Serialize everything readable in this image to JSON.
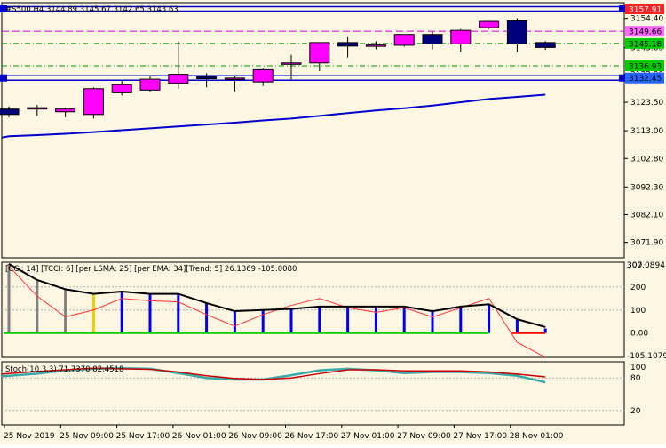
{
  "colors": {
    "background": "#fdf6e3",
    "frame": "#000000",
    "bull_candle": "#ff00ff",
    "bear_candle": "#00007a",
    "ema_line": "#0000cc",
    "hline_blue": "#0000cc",
    "hline_magenta": "#cc00cc",
    "hline_green": "#009900",
    "cci_bar_blue": "#0000ee",
    "cci_bar_gray": "#808080",
    "cci_bar_yellow": "#e8d000",
    "cci_line": "#000000",
    "cci_signal": "#ff3333",
    "cci_zero_green": "#00cc00",
    "cci_zero_red": "#ff0000",
    "stoch_main": "#3aa9a9",
    "stoch_signal": "#cc0000"
  },
  "chart_data": [
    {
      "type": "candlestick",
      "title": "#S500,H4  3144.89 3145.67 3142.65 3143.63",
      "ylim": [
        3066.2,
        3160.2
      ],
      "ylabel_ticks": [
        3154.4,
        3143.63,
        3133.9,
        3123.5,
        3113.0,
        3102.8,
        3092.3,
        3082.1,
        3071.9
      ],
      "price_labels": [
        {
          "value": 3157.91,
          "text": "3157.91",
          "bg": "#ff2222",
          "fg": "#ffffff"
        },
        {
          "value": 3149.66,
          "text": "3149.66",
          "bg": "#ff66ff",
          "fg": "#000000"
        },
        {
          "value": 3145.18,
          "text": "3145.18",
          "bg": "#00cc00",
          "fg": "#000000"
        },
        {
          "value": 3136.93,
          "text": "3136.93",
          "bg": "#00cc00",
          "fg": "#000000"
        },
        {
          "value": 3132.45,
          "text": "3132.45",
          "bg": "#2266ff",
          "fg": "#000000"
        }
      ],
      "lines": [
        {
          "kind": "blue-band",
          "value": 3157.91
        },
        {
          "kind": "magenta-dash",
          "value": 3149.66
        },
        {
          "kind": "green-dashdot",
          "value": 3145.18
        },
        {
          "kind": "green-dashdot",
          "value": 3136.93
        },
        {
          "kind": "blue-band",
          "value": 3132.45
        }
      ],
      "candles": [
        {
          "o": 3121.0,
          "h": 3122.0,
          "l": 3118.0,
          "c": 3119.0
        },
        {
          "o": 3121.0,
          "h": 3122.5,
          "l": 3118.5,
          "c": 3121.5
        },
        {
          "o": 3120.0,
          "h": 3121.5,
          "l": 3118.0,
          "c": 3121.0
        },
        {
          "o": 3119.0,
          "h": 3129.0,
          "l": 3117.5,
          "c": 3128.5
        },
        {
          "o": 3127.0,
          "h": 3131.5,
          "l": 3126.0,
          "c": 3130.0
        },
        {
          "o": 3128.0,
          "h": 3133.5,
          "l": 3127.5,
          "c": 3132.0
        },
        {
          "o": 3130.5,
          "h": 3146.0,
          "l": 3128.5,
          "c": 3133.8
        },
        {
          "o": 3133.0,
          "h": 3134.2,
          "l": 3129.0,
          "c": 3132.2
        },
        {
          "o": 3132.3,
          "h": 3133.2,
          "l": 3127.5,
          "c": 3132.4
        },
        {
          "o": 3131.0,
          "h": 3136.0,
          "l": 3129.5,
          "c": 3135.5
        },
        {
          "o": 3137.5,
          "h": 3141.0,
          "l": 3132.0,
          "c": 3138.0
        },
        {
          "o": 3138.0,
          "h": 3145.5,
          "l": 3135.0,
          "c": 3145.5
        },
        {
          "o": 3145.5,
          "h": 3147.5,
          "l": 3140.0,
          "c": 3144.2
        },
        {
          "o": 3144.3,
          "h": 3146.0,
          "l": 3143.0,
          "c": 3144.6
        },
        {
          "o": 3144.5,
          "h": 3148.6,
          "l": 3144.0,
          "c": 3148.5
        },
        {
          "o": 3148.5,
          "h": 3149.5,
          "l": 3143.0,
          "c": 3145.0
        },
        {
          "o": 3145.0,
          "h": 3150.5,
          "l": 3142.0,
          "c": 3150.0
        },
        {
          "o": 3151.0,
          "h": 3153.5,
          "l": 3150.5,
          "c": 3153.3
        },
        {
          "o": 3153.5,
          "h": 3154.5,
          "l": 3142.0,
          "c": 3145.0
        },
        {
          "o": 3145.5,
          "h": 3146.0,
          "l": 3142.8,
          "c": 3143.7
        }
      ],
      "ema": [
        3111.0,
        3111.4,
        3111.9,
        3112.5,
        3113.2,
        3113.9,
        3114.6,
        3115.3,
        3116.0,
        3116.8,
        3117.5,
        3118.5,
        3119.5,
        3120.5,
        3121.3,
        3122.3,
        3123.5,
        3124.7,
        3125.5,
        3126.3
      ]
    },
    {
      "type": "bar",
      "title": "[CCI: 14] [TCCI: 6] [per LSMA: 25] [per EMA: 34][Trend: 5]  26.1369 -105.0080",
      "ylim": [
        -105.1079,
        307.0894
      ],
      "max_label": "307.0894",
      "min_label": "-105.1079",
      "top_label": "300",
      "ticks": [
        200,
        100,
        0
      ],
      "tick_labels": [
        "200",
        "100",
        "0.00"
      ],
      "bars": [
        {
          "v": 300,
          "c": "gray"
        },
        {
          "v": 230,
          "c": "gray"
        },
        {
          "v": 190,
          "c": "gray"
        },
        {
          "v": 170,
          "c": "yellow"
        },
        {
          "v": 180,
          "c": "blue"
        },
        {
          "v": 170,
          "c": "blue"
        },
        {
          "v": 170,
          "c": "blue"
        },
        {
          "v": 130,
          "c": "blue"
        },
        {
          "v": 95,
          "c": "blue"
        },
        {
          "v": 100,
          "c": "blue"
        },
        {
          "v": 105,
          "c": "blue"
        },
        {
          "v": 115,
          "c": "blue"
        },
        {
          "v": 115,
          "c": "blue"
        },
        {
          "v": 115,
          "c": "blue"
        },
        {
          "v": 115,
          "c": "blue"
        },
        {
          "v": 95,
          "c": "blue"
        },
        {
          "v": 115,
          "c": "blue"
        },
        {
          "v": 125,
          "c": "blue"
        },
        {
          "v": 60,
          "c": "blue"
        },
        {
          "v": 20,
          "c": "blue"
        }
      ],
      "cci_line": [
        300,
        230,
        190,
        170,
        180,
        170,
        170,
        130,
        95,
        100,
        105,
        115,
        115,
        115,
        115,
        95,
        115,
        125,
        60,
        26.14
      ],
      "signal_line": [
        290,
        160,
        70,
        100,
        150,
        140,
        135,
        80,
        30,
        80,
        120,
        150,
        110,
        90,
        110,
        70,
        110,
        150,
        -40,
        -105
      ],
      "zero_line": [
        {
          "from": 0,
          "to": 17,
          "c": "green"
        },
        {
          "from": 18,
          "to": 19,
          "c": "red"
        }
      ]
    },
    {
      "type": "line",
      "title": "Stoch(10,3,3) 71.7370 82.4518",
      "ylim": [
        0,
        100
      ],
      "ticks": [
        100,
        80,
        20
      ],
      "tick_labels": [
        "100",
        "80",
        "20"
      ],
      "series": [
        {
          "role": "main",
          "values": [
            83,
            88,
            94,
            97,
            98,
            97,
            89,
            80,
            77,
            77,
            85,
            94,
            97,
            94,
            89,
            91,
            91,
            89,
            84,
            72
          ]
        },
        {
          "role": "signal",
          "values": [
            87,
            92,
            95,
            98,
            97,
            96,
            91,
            84,
            79,
            77,
            80,
            88,
            95,
            95,
            93,
            93,
            93,
            91,
            87,
            82
          ]
        }
      ]
    }
  ],
  "x_labels": [
    "25 Nov 2019",
    "25 Nov 09:00",
    "25 Nov 17:00",
    "26 Nov 01:00",
    "26 Nov 09:00",
    "26 Nov 17:00",
    "27 Nov 01:00",
    "27 Nov 09:00",
    "27 Nov 17:00",
    "28 Nov 01:00"
  ]
}
